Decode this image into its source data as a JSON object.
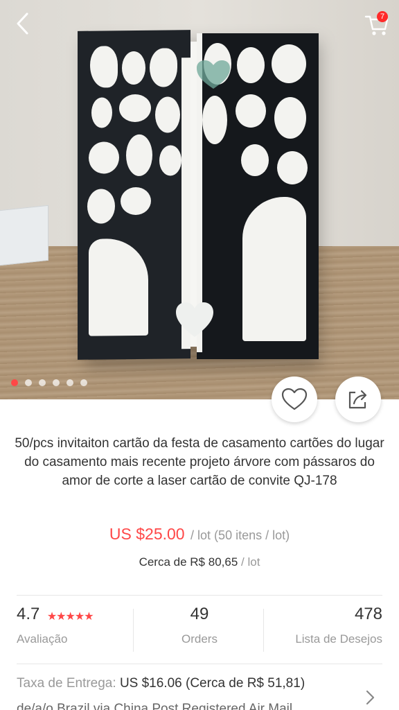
{
  "header": {
    "back_icon": "chevron-left-icon",
    "cart_icon": "cart-icon",
    "cart_count": "7"
  },
  "gallery": {
    "image_description_icon": "product-photo",
    "dots_count": 6,
    "active_dot_index": 0
  },
  "actions": {
    "wishlist_icon": "heart-outline-icon",
    "share_icon": "share-icon"
  },
  "product": {
    "title": "50/pcs invitaiton cartão da festa de casamento cartões do lugar do casamento mais recente projeto árvore com pássaros do amor de corte a laser cartão de convite QJ-178",
    "price": "US $25.00",
    "price_unit": "/ lot (50 itens / lot)",
    "approx_price": "Cerca de R$ 80,65",
    "approx_unit": "/ lot"
  },
  "stats": {
    "rating_value": "4.7",
    "rating_label": "Avaliação",
    "orders_value": "49",
    "orders_label": "Orders",
    "wishlist_value": "478",
    "wishlist_label": "Lista de Desejos"
  },
  "shipping": {
    "label": "Taxa de Entrega:",
    "value": "US $16.06 (Cerca de R$ 51,81)",
    "subtext": "de/a/o Brazil via China Post Registered Air Mail"
  },
  "colors": {
    "accent": "#ff4747",
    "muted": "#999999",
    "text": "#333333"
  }
}
